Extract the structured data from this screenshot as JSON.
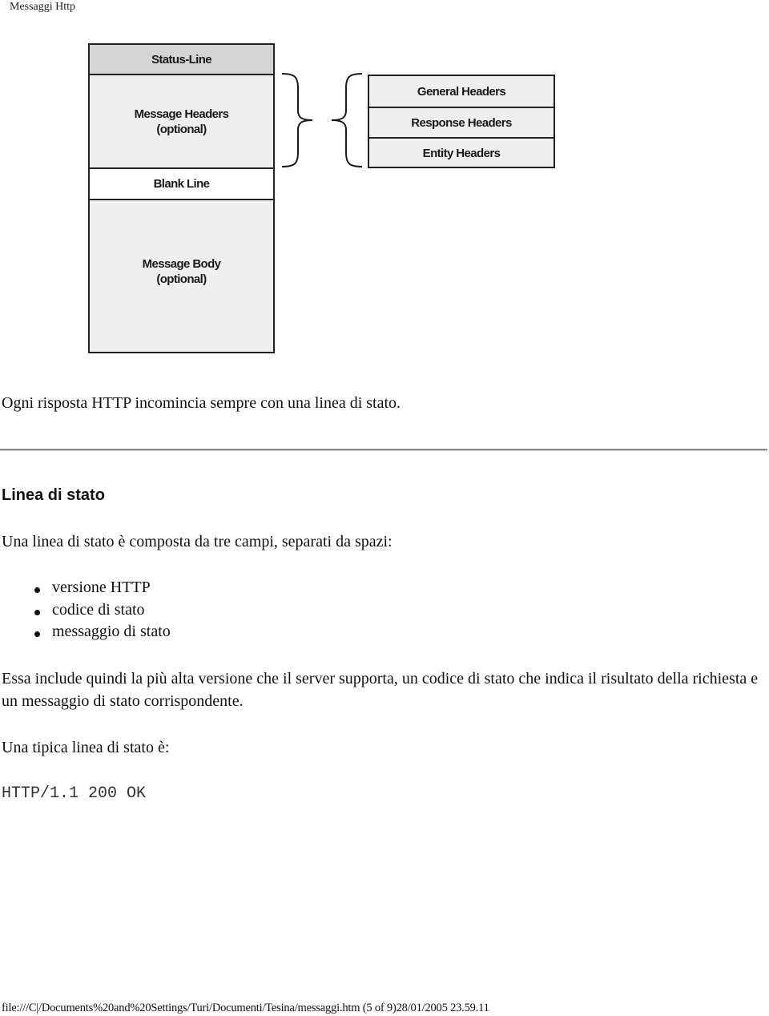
{
  "page": {
    "header_title": "Messaggi Http",
    "footer": "file:///C|/Documents%20and%20Settings/Turi/Documenti/Tesina/messaggi.htm (5 of 9)28/01/2005 23.59.11"
  },
  "diagram": {
    "message_segments": {
      "status_line": "Status-Line",
      "message_headers": [
        "Message Headers",
        "(optional)"
      ],
      "blank_line": "Blank Line",
      "message_body": [
        "Message Body",
        "(optional)"
      ]
    },
    "header_types": [
      "General Headers",
      "Response Headers",
      "Entity Headers"
    ]
  },
  "content": {
    "intro": "Ogni risposta HTTP incomincia sempre con una linea di stato.",
    "section_title": "Linea di stato",
    "lead": "Una linea di stato è composta da tre campi, separati da spazi:",
    "fields": [
      "versione HTTP",
      "codice di stato",
      "messaggio di stato"
    ],
    "explanation": "Essa include quindi la più alta versione che il server supporta, un codice di stato che indica il risultato della richiesta e un messaggio di stato corrispondente.",
    "example_label": "Una tipica linea di stato è:",
    "example_code": "HTTP/1.1 200 OK"
  }
}
